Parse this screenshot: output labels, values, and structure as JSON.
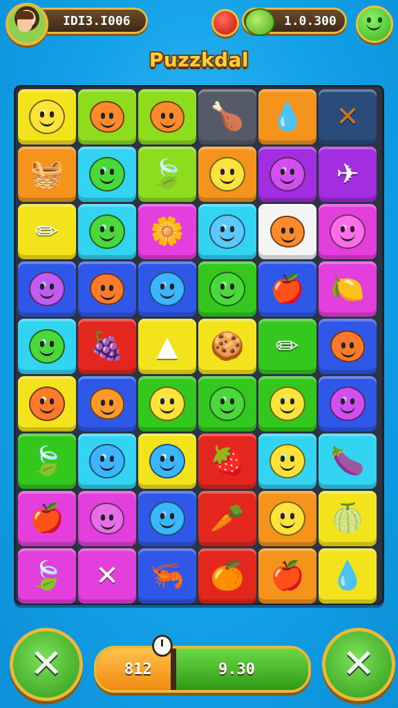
{
  "header": {
    "coins_value": "IDI3.I006",
    "gems_value": "1.0.300",
    "title": "Puzzkdal"
  },
  "colors": {
    "yellow": "#f2e31c",
    "lime": "#8ddc1e",
    "orange": "#f4941c",
    "cyan": "#33d4f2",
    "purple": "#a32ee0",
    "magenta": "#e23fdc",
    "green": "#34c81e",
    "red": "#e3261e",
    "blue": "#2f58e8",
    "white": "#f4f4f4",
    "gray": "#555b66",
    "darkblue": "#2b4b7a"
  },
  "board": {
    "rows": [
      [
        [
          "yellow",
          "smiley",
          "#ffe23a"
        ],
        [
          "lime",
          "blob",
          "#ff8a2a"
        ],
        [
          "lime",
          "blob",
          "#ff8a2a"
        ],
        [
          "gray",
          "glyph",
          "🍗"
        ],
        [
          "orange",
          "glyph",
          "💧"
        ],
        [
          "darkblue",
          "glyph",
          "✕"
        ]
      ],
      [
        [
          "orange",
          "glyph",
          "🧺"
        ],
        [
          "cyan",
          "smiley",
          "#4ad83a"
        ],
        [
          "lime",
          "glyph",
          "🍃"
        ],
        [
          "orange",
          "smiley",
          "#ffe23a"
        ],
        [
          "purple",
          "smiley",
          "#d24ef0"
        ],
        [
          "purple",
          "glyph",
          "✈"
        ]
      ],
      [
        [
          "yellow",
          "glyph",
          "✏"
        ],
        [
          "cyan",
          "smiley",
          "#4ad83a"
        ],
        [
          "magenta",
          "glyph",
          "🌼"
        ],
        [
          "cyan",
          "smiley",
          "#5cc8ff"
        ],
        [
          "white",
          "blob",
          "#ff8a2a"
        ],
        [
          "magenta",
          "smiley",
          "#ff6ee8"
        ]
      ],
      [
        [
          "blue",
          "smiley",
          "#c25cf0"
        ],
        [
          "blue",
          "blob",
          "#ff7a2a"
        ],
        [
          "blue",
          "smiley",
          "#3cb4ff"
        ],
        [
          "green",
          "smiley",
          "#4ad83a"
        ],
        [
          "blue",
          "glyph",
          "🍎"
        ],
        [
          "magenta",
          "glyph",
          "🍋"
        ]
      ],
      [
        [
          "cyan",
          "smiley",
          "#4ad83a"
        ],
        [
          "red",
          "glyph",
          "🍇"
        ],
        [
          "yellow",
          "glyph",
          "▲"
        ],
        [
          "yellow",
          "glyph",
          "🍪"
        ],
        [
          "green",
          "glyph",
          "✏"
        ],
        [
          "blue",
          "blob",
          "#ff7a2a"
        ]
      ],
      [
        [
          "yellow",
          "smiley",
          "#ff7a2a"
        ],
        [
          "blue",
          "blob",
          "#ff9a2a"
        ],
        [
          "green",
          "smiley",
          "#ffe23a"
        ],
        [
          "green",
          "smiley",
          "#4ad83a"
        ],
        [
          "green",
          "smiley",
          "#ffe23a"
        ],
        [
          "blue",
          "smiley",
          "#d24ef0"
        ]
      ],
      [
        [
          "green",
          "glyph",
          "🍃"
        ],
        [
          "cyan",
          "smiley",
          "#3cb4ff"
        ],
        [
          "yellow",
          "smiley",
          "#3cb4ff"
        ],
        [
          "red",
          "glyph",
          "🍓"
        ],
        [
          "cyan",
          "smiley",
          "#ffe23a"
        ],
        [
          "cyan",
          "glyph",
          "🍆"
        ]
      ],
      [
        [
          "magenta",
          "glyph",
          "🍎"
        ],
        [
          "magenta",
          "blob",
          "#e86ee8"
        ],
        [
          "blue",
          "smiley",
          "#3cb4ff"
        ],
        [
          "red",
          "glyph",
          "🥕"
        ],
        [
          "orange",
          "smiley",
          "#ffe23a"
        ],
        [
          "yellow",
          "glyph",
          "🍈"
        ]
      ],
      [
        [
          "magenta",
          "glyph",
          "🍃"
        ],
        [
          "magenta",
          "glyph",
          "✕"
        ],
        [
          "blue",
          "glyph",
          "🦐"
        ],
        [
          "red",
          "glyph",
          "🍊"
        ],
        [
          "orange",
          "glyph",
          "🍎"
        ],
        [
          "yellow",
          "glyph",
          "💧"
        ]
      ]
    ]
  },
  "footer": {
    "left_value": "812",
    "right_value": "9.30",
    "progress": 0.36
  }
}
